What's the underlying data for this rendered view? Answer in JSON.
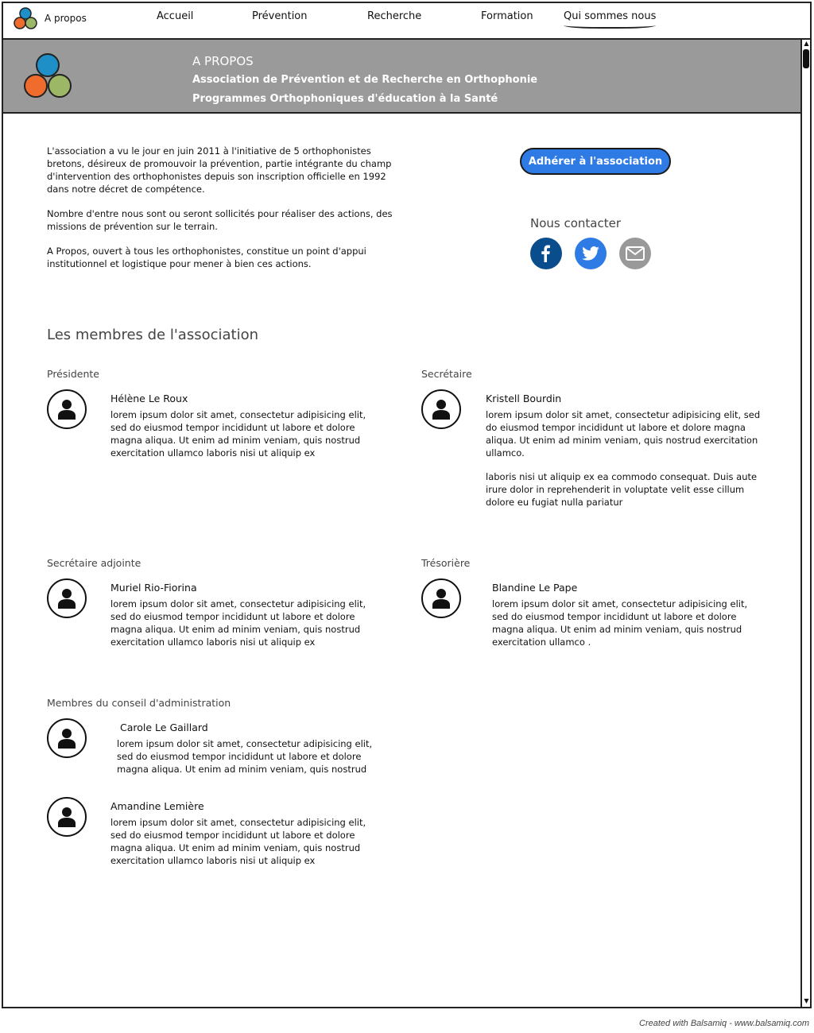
{
  "nav": {
    "brand_label": "A propos",
    "items": [
      "Accueil",
      "Prévention",
      "Recherche",
      "Formation",
      "Qui sommes nous"
    ]
  },
  "banner": {
    "title": "A PROPOS",
    "line1": "Association de Prévention et de Recherche en Orthophonie",
    "line2": "Programmes Orthophoniques d'éducation à la Santé"
  },
  "intro": {
    "p1": "L'association a vu le jour en juin 2011 à l'initiative de 5 orthophonistes bretons, désireux de promouvoir la prévention, partie intégrante du champ d'intervention des orthophonistes depuis son inscription officielle en 1992 dans notre décret de compétence.",
    "p2": "Nombre d'entre nous sont ou seront sollicités pour réaliser des actions, des missions de prévention sur le terrain.",
    "p3": "A Propos, ouvert à tous les orthophonistes, constitue un point d'appui institutionnel et logistique pour mener à bien ces actions."
  },
  "join_button": "Adhérer à l'association",
  "contact": {
    "label": "Nous contacter",
    "icons": [
      "facebook-icon",
      "twitter-icon",
      "mail-icon"
    ]
  },
  "colors": {
    "accent": "#2f7be6",
    "facebook": "#0a4d8c",
    "twitter": "#2f7be6",
    "mail": "#999999",
    "banner": "#9a9a9a"
  },
  "members_title": "Les membres de l'association",
  "members": {
    "presidente": {
      "role": "Présidente",
      "name": "Hélène Le Roux",
      "bio": "lorem ipsum dolor sit amet, consectetur adipisicing elit, sed do eiusmod tempor incididunt ut labore et dolore magna aliqua. Ut enim ad minim veniam, quis nostrud exercitation ullamco laboris nisi ut aliquip ex"
    },
    "secretaire": {
      "role": "Secrétaire",
      "name": "Kristell Bourdin",
      "bio": "lorem ipsum dolor sit amet, consectetur adipisicing elit, sed do eiusmod tempor incididunt ut labore et dolore magna aliqua. Ut enim ad minim veniam, quis nostrud exercitation ullamco.",
      "bio2": "laboris nisi ut aliquip ex ea commodo consequat. Duis aute irure dolor in reprehenderit in voluptate velit esse cillum dolore eu fugiat nulla pariatur"
    },
    "secretaire_adjointe": {
      "role": "Secrétaire adjointe",
      "name": "Muriel Rio-Fiorina",
      "bio": "lorem ipsum dolor sit amet, consectetur adipisicing elit, sed do eiusmod tempor incididunt ut labore et dolore magna aliqua. Ut enim ad minim veniam, quis nostrud exercitation ullamco laboris nisi ut aliquip ex"
    },
    "tresoriere": {
      "role": "Trésorière",
      "name": "Blandine Le Pape",
      "bio": "lorem ipsum dolor sit amet, consectetur adipisicing elit, sed do eiusmod tempor incididunt ut labore et dolore magna aliqua. Ut enim ad minim veniam, quis nostrud exercitation ullamco ."
    },
    "conseil": {
      "role": "Membres du conseil d'administration",
      "carole": {
        "name": "Carole Le Gaillard",
        "bio": "lorem ipsum dolor sit amet, consectetur adipisicing elit, sed do eiusmod tempor incididunt ut labore et dolore magna aliqua. Ut enim ad minim veniam, quis nostrud"
      },
      "amandine": {
        "name": "Amandine Lemière",
        "bio": "lorem ipsum dolor sit amet, consectetur adipisicing elit, sed do eiusmod tempor incididunt ut labore et dolore magna aliqua. Ut enim ad minim veniam, quis nostrud exercitation ullamco laboris nisi ut aliquip ex"
      }
    }
  },
  "credit": "Created with Balsamiq - www.balsamiq.com"
}
